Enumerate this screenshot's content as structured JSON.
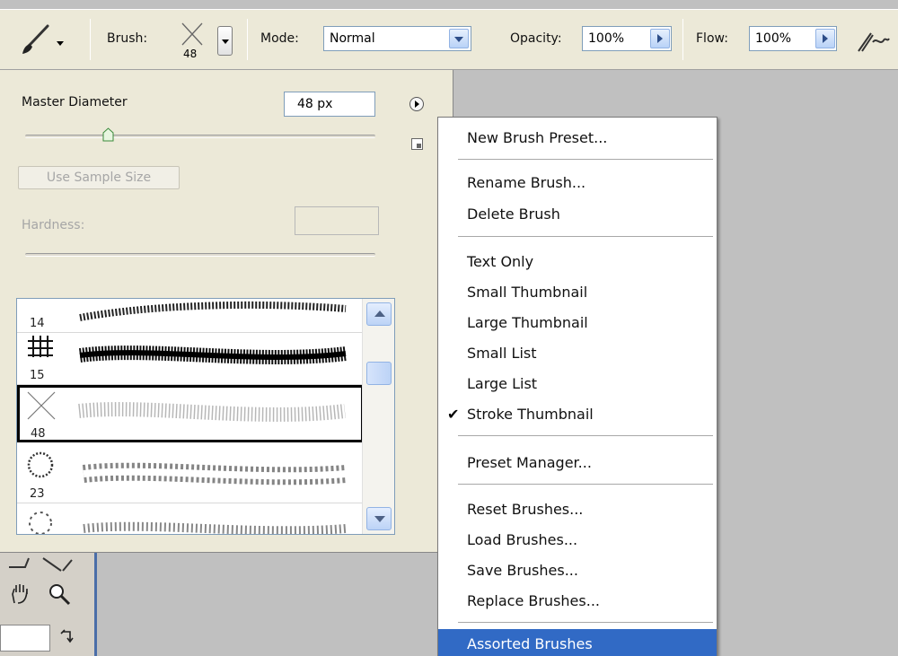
{
  "options_bar": {
    "brush_label": "Brush:",
    "brush_size": "48",
    "mode_label": "Mode:",
    "mode_value": "Normal",
    "opacity_label": "Opacity:",
    "opacity_value": "100%",
    "flow_label": "Flow:",
    "flow_value": "100%",
    "icons": [
      "brush-tool-icon",
      "airbrush-icon"
    ]
  },
  "brush_panel": {
    "master_diameter_label": "Master Diameter",
    "master_diameter_value": "48 px",
    "use_sample_size_label": "Use Sample Size",
    "hardness_label": "Hardness:",
    "presets": [
      {
        "size": "14",
        "selected": false
      },
      {
        "size": "15",
        "selected": false
      },
      {
        "size": "48",
        "selected": true
      },
      {
        "size": "23",
        "selected": false
      }
    ]
  },
  "menu": {
    "groups": [
      [
        "New Brush Preset..."
      ],
      [
        "Rename Brush...",
        "Delete Brush"
      ],
      [
        "Text Only",
        "Small Thumbnail",
        "Large Thumbnail",
        "Small List",
        "Large List",
        "Stroke Thumbnail"
      ],
      [
        "Preset Manager..."
      ],
      [
        "Reset Brushes...",
        "Load Brushes...",
        "Save Brushes...",
        "Replace Brushes..."
      ],
      [
        "Assorted Brushes"
      ]
    ],
    "checked_item": "Stroke Thumbnail",
    "highlighted_item": "Assorted Brushes"
  },
  "colors": {
    "highlight": "#316ac5",
    "panel_bg": "#ece9d8",
    "canvas_bg": "#c0c0c0"
  }
}
